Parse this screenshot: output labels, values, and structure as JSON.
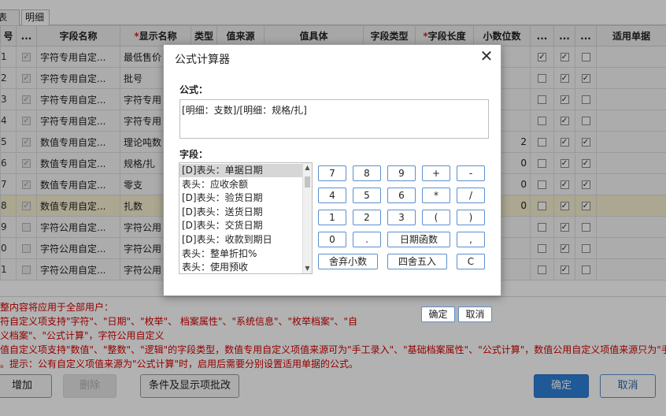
{
  "tabs": [
    "表头",
    "明细"
  ],
  "grid": {
    "headers": [
      "号",
      "...",
      "字段名称",
      "显示名称",
      "类型",
      "值来源",
      "值具体",
      "字段类型",
      "字段长度",
      "小数位数",
      "...",
      "...",
      "...",
      "适用单据"
    ],
    "required_mark": "*",
    "rows": [
      {
        "no": "1",
        "name": "字符专用自定...",
        "display": "最低售价",
        "decimal": "",
        "c11": true,
        "c12": true,
        "c13": false
      },
      {
        "no": "2",
        "name": "字符专用自定...",
        "display": "批号",
        "decimal": "",
        "c11": false,
        "c12": true,
        "c13": true
      },
      {
        "no": "3",
        "name": "字符专用自定...",
        "display": "字符专用",
        "decimal": "",
        "c11": false,
        "c12": true,
        "c13": false
      },
      {
        "no": "4",
        "name": "字符专用自定...",
        "display": "字符专用",
        "decimal": "",
        "c11": false,
        "c12": true,
        "c13": false
      },
      {
        "no": "5",
        "name": "数值专用自定...",
        "display": "理论吨数",
        "decimal": "2",
        "c11": false,
        "c12": true,
        "c13": true
      },
      {
        "no": "6",
        "name": "数值专用自定...",
        "display": "规格/扎",
        "decimal": "0",
        "c11": false,
        "c12": true,
        "c13": true
      },
      {
        "no": "7",
        "name": "数值专用自定...",
        "display": "零支",
        "decimal": "0",
        "c11": false,
        "c12": true,
        "c13": true
      },
      {
        "no": "8",
        "name": "数值专用自定...",
        "display": "扎数",
        "decimal": "0",
        "c11": false,
        "c12": true,
        "c13": true
      },
      {
        "no": "9",
        "name": "字符公用自定...",
        "display": "字符公用",
        "decimal": "",
        "c11": false,
        "c12": true,
        "c13": false
      },
      {
        "no": "0",
        "name": "字符公用自定...",
        "display": "字符公用",
        "decimal": "",
        "c11": false,
        "c12": true,
        "c13": false
      },
      {
        "no": "1",
        "name": "字符公用自定...",
        "display": "字符公用",
        "decimal": "",
        "c11": false,
        "c12": true,
        "c13": false
      }
    ]
  },
  "notes": [
    "整内容将应用于全部用户：",
    "符自定义项支持\"字符\"、\"日期\"、\"枚举\"、                                                                                              档案属性\"、\"系统信息\"、\"枚举档案\"、\"自",
    "义档案\"、\"公式计算\"，字符公用自定义",
    "值自定义项支持\"数值\"、\"整数\"、\"逻辑\"的字段类型，数值专用自定义项值来源可为\"手工录入\"、\"基础档案属性\"、\"公式计算\"，数值公用自定义项值来源只为\"手工录",
    "。提示：公有自定义项值来源为\"公式计算\"时，启用后需要分别设置适用单据的公式。"
  ],
  "footer": {
    "add": "增加",
    "delete": "删除",
    "conditions": "条件及显示项批改",
    "ok": "确定",
    "cancel": "取消"
  },
  "dialog": {
    "title": "公式计算器",
    "close": "✕",
    "formula_label": "公式：",
    "formula_value": "[明细：支数]/[明细：规格/扎]",
    "fields_label": "字段：",
    "fields": [
      "[D]表头：单据日期",
      "表头：应收余额",
      "[D]表头：验货日期",
      "[D]表头：送货日期",
      "[D]表头：交货日期",
      "[D]表头：收款到期日",
      "表头：整单折扣%",
      "表头：使用预收"
    ],
    "selected_field": 0,
    "keys_row1": [
      "7",
      "8",
      "9",
      "+",
      "-"
    ],
    "keys_row2": [
      "4",
      "5",
      "6",
      "*",
      "/"
    ],
    "keys_row3": [
      "1",
      "2",
      "3",
      "(",
      ")"
    ],
    "keys_row4": [
      "0",
      ".",
      "日期函数",
      ","
    ],
    "keys_row5": [
      "舍弃小数",
      "四舍五入",
      "C"
    ],
    "ok": "确定",
    "cancel": "取消"
  },
  "colors": {
    "accent": "#2f80d8",
    "key_border": "#5b8fcf",
    "note_text": "#d40000",
    "selected_row": "#f5efcf"
  }
}
